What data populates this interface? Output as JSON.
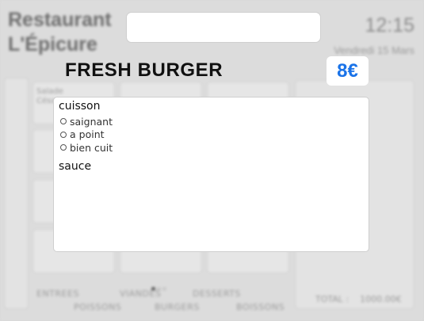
{
  "background": {
    "title_line1": "Restaurant",
    "title_line2": "L'Épicure",
    "clock": "12:15",
    "date": "Vendredi 15 Mars",
    "tile_label_line1": "Salade",
    "tile_label_line2": "César",
    "categories": [
      "ENTREES",
      "POISSONS",
      "VIANDES",
      "BURGERS",
      "DESSERTS",
      "BOISSONS"
    ],
    "cart_total_label": "TOTAL :",
    "cart_total_value": "1000.00€"
  },
  "product": {
    "name": "FRESH BURGER",
    "price": "8€"
  },
  "options": {
    "groups": [
      {
        "title": "cuisson",
        "choices": [
          "saignant",
          "a point",
          "bien cuit"
        ]
      },
      {
        "title": "sauce",
        "choices": []
      }
    ]
  }
}
